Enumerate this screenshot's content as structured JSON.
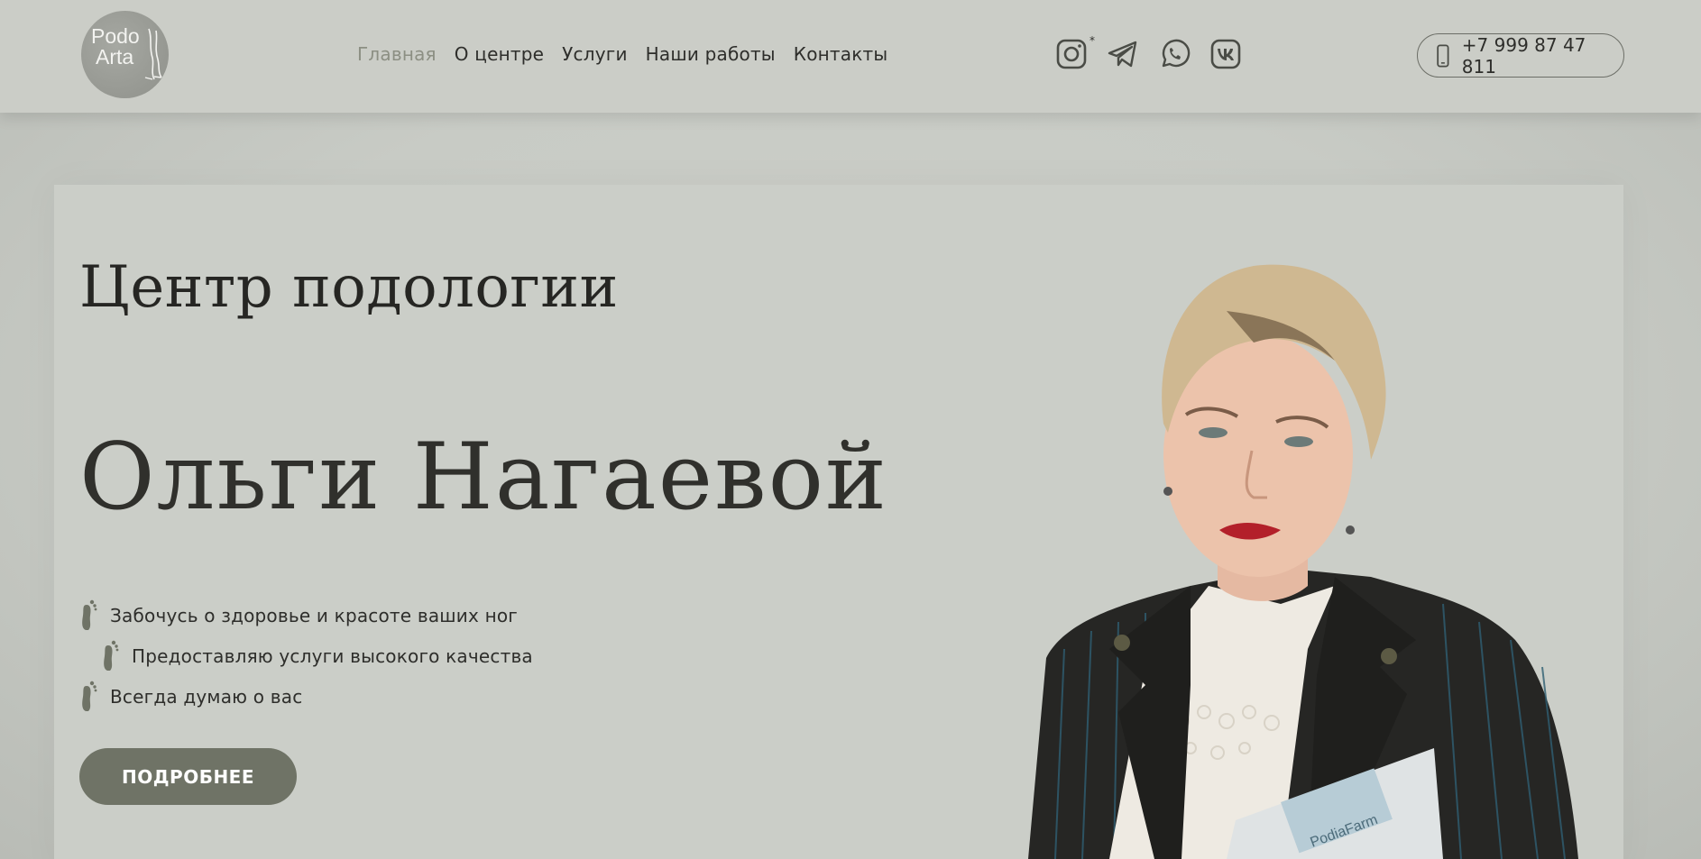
{
  "header": {
    "logo": {
      "line1": "Podo",
      "line2": "Arta"
    },
    "nav": [
      {
        "label": "Главная",
        "active": true
      },
      {
        "label": "О центре"
      },
      {
        "label": "Услуги"
      },
      {
        "label": "Наши работы"
      },
      {
        "label": "Контакты"
      }
    ],
    "socials": [
      {
        "icon": "instagram-icon",
        "mark": "*"
      },
      {
        "icon": "telegram-icon"
      },
      {
        "icon": "whatsapp-icon"
      },
      {
        "icon": "vk-icon"
      }
    ],
    "phone": {
      "icon": "phone-icon",
      "number": "+7 999 87 47 811"
    }
  },
  "hero": {
    "title_line1": "Центр подологии",
    "title_line2": "Ольги Нагаевой",
    "features": [
      {
        "icon": "foot-icon",
        "text": "Забочусь о здоровье и красоте ваших ног"
      },
      {
        "icon": "foot-icon",
        "text": "Предоставляю услуги высокого качества"
      },
      {
        "icon": "foot-icon",
        "text": "Всегда думаю о вас"
      }
    ],
    "cta_label": "ПОДРОБНЕЕ",
    "portrait_brochure_text": "PodiaFarm"
  },
  "colors": {
    "background": "#c9ccc6",
    "accent": "#6f7366",
    "active_nav": "#8c8f83",
    "text": "#2e2e2b"
  }
}
